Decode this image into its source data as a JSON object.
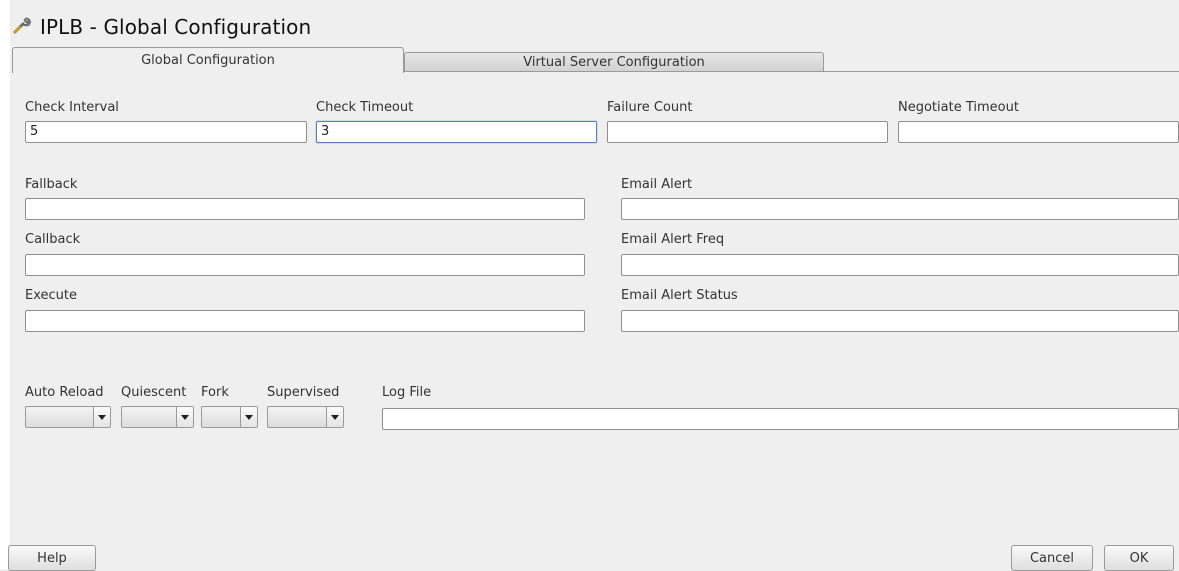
{
  "window": {
    "title": "IPLB - Global Configuration",
    "icon": "wrench-icon"
  },
  "tabs": [
    {
      "label": "Global Configuration",
      "active": true
    },
    {
      "label": "Virtual Server Configuration",
      "active": false
    }
  ],
  "fields": {
    "check_interval": {
      "label": "Check Interval",
      "value": "5"
    },
    "check_timeout": {
      "label": "Check Timeout",
      "value": "3"
    },
    "failure_count": {
      "label": "Failure Count",
      "value": ""
    },
    "negotiate_timeout": {
      "label": "Negotiate Timeout",
      "value": ""
    },
    "fallback": {
      "label": "Fallback",
      "value": ""
    },
    "email_alert": {
      "label": "Email Alert",
      "value": ""
    },
    "callback": {
      "label": "Callback",
      "value": ""
    },
    "email_alert_freq": {
      "label": "Email Alert Freq",
      "value": ""
    },
    "execute": {
      "label": "Execute",
      "value": ""
    },
    "email_alert_status": {
      "label": "Email Alert Status",
      "value": ""
    },
    "log_file": {
      "label": "Log File",
      "value": ""
    }
  },
  "combos": {
    "auto_reload": {
      "label": "Auto Reload",
      "value": ""
    },
    "quiescent": {
      "label": "Quiescent",
      "value": ""
    },
    "fork": {
      "label": "Fork",
      "value": ""
    },
    "supervised": {
      "label": "Supervised",
      "value": ""
    }
  },
  "buttons": {
    "help": "Help",
    "cancel": "Cancel",
    "ok": "OK"
  }
}
